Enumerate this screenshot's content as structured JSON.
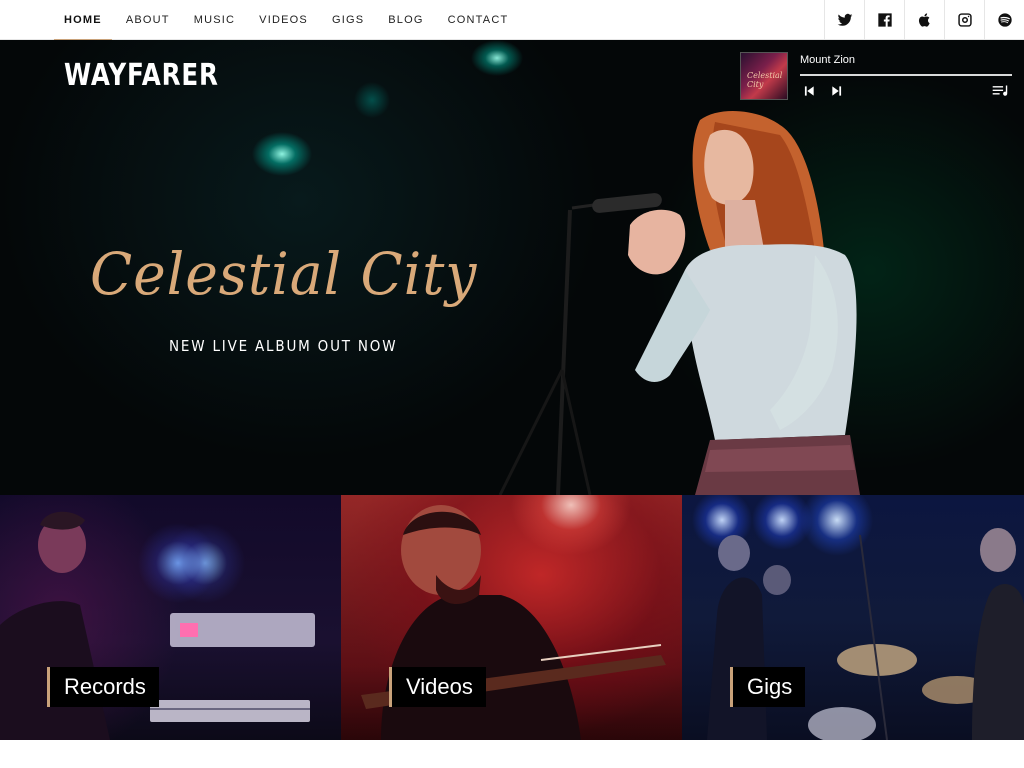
{
  "nav": {
    "items": [
      {
        "label": "HOME",
        "active": true
      },
      {
        "label": "ABOUT",
        "active": false
      },
      {
        "label": "MUSIC",
        "active": false
      },
      {
        "label": "VIDEOS",
        "active": false
      },
      {
        "label": "GIGS",
        "active": false
      },
      {
        "label": "BLOG",
        "active": false
      },
      {
        "label": "CONTACT",
        "active": false
      }
    ],
    "accent_color": "#c9a27a"
  },
  "social": {
    "icons": [
      "twitter-icon",
      "facebook-icon",
      "apple-icon",
      "instagram-icon",
      "spotify-icon"
    ]
  },
  "hero": {
    "brand": "WAYFARER",
    "album_title": "Celestial City",
    "tagline": "NEW LIVE ALBUM OUT NOW",
    "title_color": "#d9a979"
  },
  "player": {
    "track_title": "Mount Zion",
    "cover_text": "Celestial City",
    "icons": [
      "previous-icon",
      "next-icon",
      "playlist-icon"
    ]
  },
  "tiles": [
    {
      "label": "Records"
    },
    {
      "label": "Videos"
    },
    {
      "label": "Gigs"
    }
  ]
}
